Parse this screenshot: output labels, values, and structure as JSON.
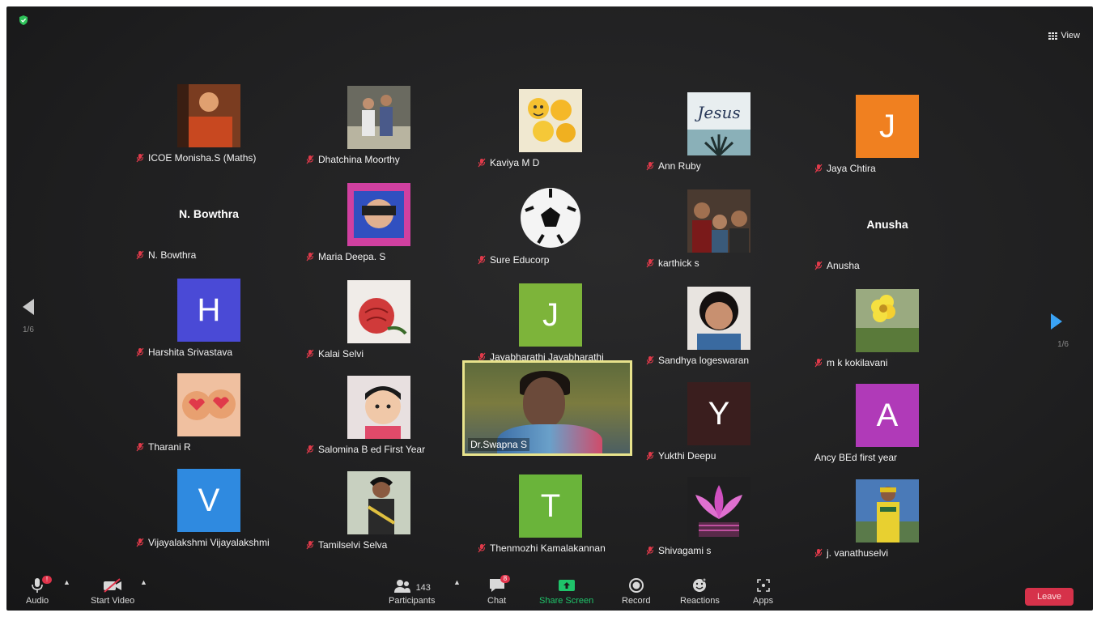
{
  "top": {
    "view_label": "View"
  },
  "pages": {
    "left": "1/6",
    "right": "1/6"
  },
  "participants": [
    {
      "name": "ICOE Monisha.S (Maths)",
      "thumb": "photo-warm"
    },
    {
      "name": "Dhatchina Moorthy",
      "thumb": "photo-people"
    },
    {
      "name": "Kaviya M D",
      "thumb": "photo-emoji"
    },
    {
      "name": "Ann Ruby",
      "thumb": "photo-jesus",
      "thumb_text": "Jesus"
    },
    {
      "name": "Jaya Chtira",
      "thumb": "letter",
      "letter": "J",
      "color": "#f08020"
    },
    {
      "name": "N. Bowthra",
      "thumb": "name",
      "display_name": "N. Bowthra"
    },
    {
      "name": "Maria Deepa. S",
      "thumb": "photo-pink"
    },
    {
      "name": "Sure Educorp",
      "thumb": "photo-ball"
    },
    {
      "name": "karthick s",
      "thumb": "photo-group"
    },
    {
      "name": "Anusha",
      "thumb": "name",
      "display_name": "Anusha"
    },
    {
      "name": "Harshita Srivastava",
      "thumb": "letter",
      "letter": "H",
      "color": "#4a4ad6"
    },
    {
      "name": "Kalai Selvi",
      "thumb": "photo-rose"
    },
    {
      "name": "Jayabharathi Jayabharathi",
      "thumb": "letter",
      "letter": "J",
      "color": "#7db43a"
    },
    {
      "name": "Sandhya logeswaran",
      "thumb": "photo-woman"
    },
    {
      "name": "m k kokilavani",
      "thumb": "photo-flower"
    },
    {
      "name": "Tharani R",
      "thumb": "photo-hearts"
    },
    {
      "name": "Salomina B ed First Year",
      "thumb": "photo-baby"
    },
    {
      "name": "Dr.Swapna S",
      "thumb": "active"
    },
    {
      "name": "Yukthi Deepu",
      "thumb": "letter",
      "letter": "Y",
      "color": "#3a1e1e"
    },
    {
      "name": "Ancy BEd first year",
      "thumb": "letter",
      "letter": "A",
      "color": "#b03ab8",
      "muted": false
    },
    {
      "name": "Vijayalakshmi Vijayalakshmi",
      "thumb": "letter",
      "letter": "V",
      "color": "#2f8ae0"
    },
    {
      "name": "Tamilselvi Selva",
      "thumb": "photo-lady"
    },
    {
      "name": "Thenmozhi Kamalakannan",
      "thumb": "letter",
      "letter": "T",
      "color": "#6ab43a"
    },
    {
      "name": "Shivagami s",
      "thumb": "photo-lotus"
    },
    {
      "name": "j. vanathuselvi",
      "thumb": "photo-cricket"
    }
  ],
  "toolbar": {
    "audio": "Audio",
    "start_video": "Start Video",
    "participants": "Participants",
    "participants_count": "143",
    "chat": "Chat",
    "chat_badge": "8",
    "audio_badge": "!",
    "share_screen": "Share Screen",
    "record": "Record",
    "reactions": "Reactions",
    "apps": "Apps",
    "leave": "Leave"
  },
  "colors": {
    "accent_share": "#1fc46a",
    "leave": "#d6324a",
    "active_border": "#e8e38c"
  }
}
